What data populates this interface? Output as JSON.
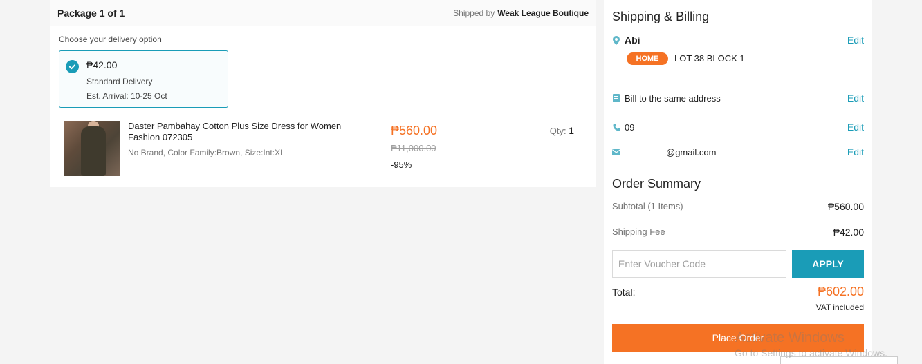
{
  "package": {
    "title": "Package 1 of 1",
    "shipped_by_label": "Shipped by",
    "seller": "Weak League Boutique",
    "choose_label": "Choose your delivery option",
    "delivery": {
      "price": "₱42.00",
      "name": "Standard Delivery",
      "arrival": "Est. Arrival: 10-25 Oct"
    },
    "product": {
      "name": "Daster Pambahay Cotton Plus Size Dress for Women Fashion 072305",
      "variant": "No Brand, Color Family:Brown, Size:Int:XL",
      "price": "₱560.00",
      "original_price": "₱11,000.00",
      "discount": "-95%",
      "qty_label": "Qty:",
      "qty": "1"
    }
  },
  "shipping": {
    "heading": "Shipping & Billing",
    "name": "Abi",
    "badge": "HOME",
    "address": "LOT 38 BLOCK 1",
    "bill": "Bill to the same address",
    "phone": "09",
    "email": "@gmail.com",
    "edit_label": "Edit"
  },
  "summary": {
    "heading": "Order Summary",
    "subtotal_label": "Subtotal (1 Items)",
    "subtotal": "₱560.00",
    "shipping_label": "Shipping Fee",
    "shipping": "₱42.00",
    "voucher_placeholder": "Enter Voucher Code",
    "apply_label": "APPLY",
    "total_label": "Total:",
    "total": "₱602.00",
    "vat": "VAT included",
    "place_order": "Place Order"
  },
  "watermark": {
    "line1": "Activate Windows",
    "line2": "Go to Settings to activate Windows."
  },
  "colors": {
    "accent": "#f57224",
    "teal": "#1a9cb7"
  }
}
